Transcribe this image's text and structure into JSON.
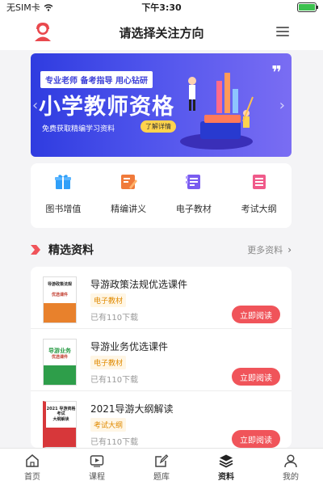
{
  "status_bar": {
    "carrier": "无SIM卡",
    "time": "下午3:30",
    "battery_level": 1.0
  },
  "header": {
    "title": "请选择关注方向"
  },
  "banner": {
    "tagline": "专业老师 备考指导 用心钻研",
    "headline": "小学教师资格",
    "subtitle": "免费获取精编学习资料",
    "button": "了解详情",
    "quote": "❞"
  },
  "quick_links": [
    {
      "label": "图书增值",
      "icon": "gift-icon",
      "color": "#2f9ff8"
    },
    {
      "label": "精编讲义",
      "icon": "handout-icon",
      "color": "#f07a3a"
    },
    {
      "label": "电子教材",
      "icon": "ebook-icon",
      "color": "#7a5cf0"
    },
    {
      "label": "考试大纲",
      "icon": "outline-icon",
      "color": "#f05a8a"
    }
  ],
  "section": {
    "title": "精选资料",
    "more": "更多资料",
    "chevron": "›"
  },
  "materials": [
    {
      "title": "导游政策法规优选课件",
      "tag": "电子教材",
      "downloads": "已有110下载",
      "button": "立即阅读",
      "cover_title": "导游政策法规",
      "cover_sub": "优选课件",
      "cover_color": "#e8812c"
    },
    {
      "title": "导游业务优选课件",
      "tag": "电子教材",
      "downloads": "已有110下载",
      "button": "立即阅读",
      "cover_title": "导游业务",
      "cover_sub": "优选课件",
      "cover_color": "#2e9e4a"
    },
    {
      "title": "2021导游大纲解读",
      "tag": "考试大纲",
      "downloads": "已有110下载",
      "button": "立即阅读",
      "cover_title": "2021 导游资格考试",
      "cover_sub": "大纲解读",
      "cover_color": "#d7373a"
    }
  ],
  "tabs": [
    {
      "label": "首页",
      "icon": "home-icon"
    },
    {
      "label": "课程",
      "icon": "video-icon"
    },
    {
      "label": "题库",
      "icon": "edit-icon"
    },
    {
      "label": "资料",
      "icon": "layers-icon",
      "active": true
    },
    {
      "label": "我的",
      "icon": "user-icon"
    }
  ]
}
